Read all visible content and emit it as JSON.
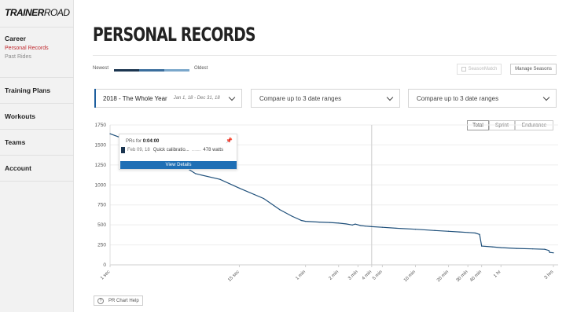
{
  "app": {
    "logo_bold": "TRAINER",
    "logo_thin": "ROAD"
  },
  "sidebar": {
    "sections": [
      {
        "label": "Career",
        "items": [
          {
            "label": "Personal Records",
            "active": true
          },
          {
            "label": "Past Rides",
            "active": false
          }
        ]
      },
      {
        "label": "Training Plans",
        "items": []
      },
      {
        "label": "Workouts",
        "items": []
      },
      {
        "label": "Teams",
        "items": []
      },
      {
        "label": "Account",
        "items": []
      }
    ]
  },
  "page": {
    "title": "PERSONAL RECORDS"
  },
  "legend": {
    "newest": "Newest",
    "oldest": "Oldest",
    "colors": [
      "#1b3550",
      "#3a6d9c",
      "#7aa7cb",
      "#c9dceb"
    ]
  },
  "toolbar": {
    "seasonmatch_label": "SeasonMatch",
    "manage_seasons_label": "Manage Seasons"
  },
  "ranges": {
    "primary": {
      "label": "2018 - The Whole Year",
      "dates": "Jan 1, 18 - Dec 31, 18"
    },
    "compare_1": {
      "label": "Compare up to 3 date ranges"
    },
    "compare_2": {
      "label": "Compare up to 3 date ranges"
    }
  },
  "filters": {
    "options": [
      "Total",
      "Sprint",
      "Endurance"
    ],
    "selected": "Total"
  },
  "tooltip": {
    "prefix": "PRs for",
    "duration": "0:04:00",
    "date": "Feb 09, 18",
    "workout": "Quick calibratio...",
    "dots": "..........",
    "value": "478 watts",
    "button_label": "View Details"
  },
  "help": {
    "label": "PR Chart Help"
  },
  "chart_data": {
    "type": "line",
    "series_color": "#1e4f7a",
    "accent_color": "#1f6fb5",
    "y_ticks": [
      0,
      250,
      500,
      750,
      1000,
      1250,
      1500,
      1750
    ],
    "ylim": [
      0,
      1750
    ],
    "x_ticks": [
      {
        "label": "1 sec",
        "t": 1
      },
      {
        "label": "15 sec",
        "t": 15
      },
      {
        "label": "1 min",
        "t": 60
      },
      {
        "label": "2 min",
        "t": 120
      },
      {
        "label": "3 min",
        "t": 180
      },
      {
        "label": "4 min",
        "t": 240
      },
      {
        "label": "5 min",
        "t": 300
      },
      {
        "label": "10 min",
        "t": 600
      },
      {
        "label": "20 min",
        "t": 1200
      },
      {
        "label": "30 min",
        "t": 1800
      },
      {
        "label": "40 min",
        "t": 2400
      },
      {
        "label": "1 hr",
        "t": 3600
      },
      {
        "label": "3 hrs",
        "t": 10800
      }
    ],
    "crosshair_t": 240,
    "grid": true,
    "points": [
      {
        "t": 1,
        "w": 1640
      },
      {
        "t": 3,
        "w": 1400
      },
      {
        "t": 6,
        "w": 1140
      },
      {
        "t": 10,
        "w": 1070
      },
      {
        "t": 15,
        "w": 960
      },
      {
        "t": 25,
        "w": 830
      },
      {
        "t": 35,
        "w": 690
      },
      {
        "t": 45,
        "w": 610
      },
      {
        "t": 55,
        "w": 555
      },
      {
        "t": 60,
        "w": 545
      },
      {
        "t": 80,
        "w": 535
      },
      {
        "t": 100,
        "w": 530
      },
      {
        "t": 120,
        "w": 522
      },
      {
        "t": 140,
        "w": 512
      },
      {
        "t": 160,
        "w": 498
      },
      {
        "t": 170,
        "w": 510
      },
      {
        "t": 190,
        "w": 492
      },
      {
        "t": 210,
        "w": 485
      },
      {
        "t": 240,
        "w": 478
      },
      {
        "t": 300,
        "w": 470
      },
      {
        "t": 400,
        "w": 458
      },
      {
        "t": 600,
        "w": 445
      },
      {
        "t": 900,
        "w": 430
      },
      {
        "t": 1200,
        "w": 420
      },
      {
        "t": 1500,
        "w": 412
      },
      {
        "t": 1800,
        "w": 405
      },
      {
        "t": 2100,
        "w": 398
      },
      {
        "t": 2300,
        "w": 380
      },
      {
        "t": 2400,
        "w": 235
      },
      {
        "t": 3000,
        "w": 225
      },
      {
        "t": 3600,
        "w": 215
      },
      {
        "t": 5000,
        "w": 205
      },
      {
        "t": 7000,
        "w": 200
      },
      {
        "t": 9000,
        "w": 195
      },
      {
        "t": 9800,
        "w": 180
      },
      {
        "t": 10000,
        "w": 155
      },
      {
        "t": 10800,
        "w": 150
      }
    ]
  }
}
